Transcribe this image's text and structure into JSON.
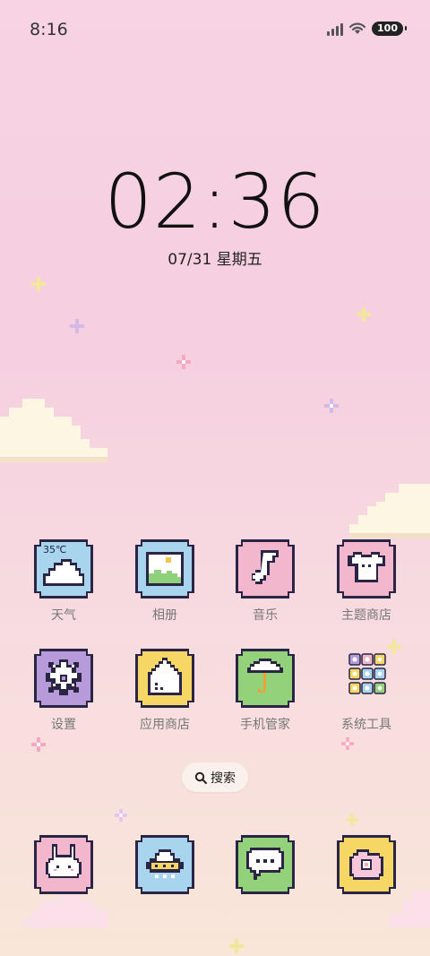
{
  "status": {
    "time": "8:16",
    "battery": "100"
  },
  "lockclock": {
    "time": "02:36",
    "date": "07/31 星期五"
  },
  "weather": {
    "temp": "35℃"
  },
  "apps_row1": [
    {
      "label": "天气",
      "icon": "weather-cloud-icon",
      "color": "#a8d4ee"
    },
    {
      "label": "相册",
      "icon": "gallery-picture-icon",
      "color": "#a8d4ee"
    },
    {
      "label": "音乐",
      "icon": "music-note-icon",
      "color": "#f2b7cd"
    },
    {
      "label": "主题商店",
      "icon": "tshirt-icon",
      "color": "#f2b7cd"
    }
  ],
  "apps_row2": [
    {
      "label": "设置",
      "icon": "gear-icon",
      "color": "#b79ad9"
    },
    {
      "label": "应用商店",
      "icon": "house-icon",
      "color": "#f6d766"
    },
    {
      "label": "手机管家",
      "icon": "umbrella-icon",
      "color": "#93d27a"
    },
    {
      "label": "系统工具",
      "icon": "folder-grid-icon",
      "color": "#f7dbe4"
    }
  ],
  "dock": [
    {
      "icon": "bunny-icon",
      "color": "#f2b7cd"
    },
    {
      "icon": "ufo-icon",
      "color": "#a8d4ee"
    },
    {
      "icon": "chat-bubble-icon",
      "color": "#93d27a"
    },
    {
      "icon": "camera-icon",
      "color": "#f6d766"
    }
  ],
  "search": {
    "label": "搜索"
  }
}
